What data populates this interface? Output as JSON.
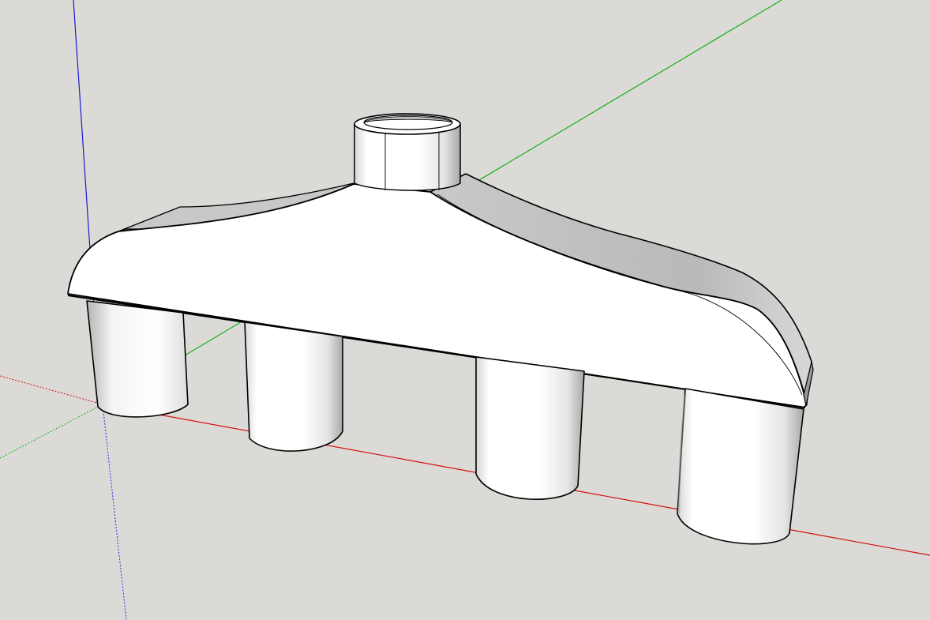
{
  "viewport": {
    "background": "#dcdad6"
  },
  "axes": {
    "x_axis_color": "#cc0000",
    "y_axis_color": "#00aa00",
    "z_axis_color": "#0000cc"
  },
  "model": {
    "face_color": "#ffffff",
    "shade_color": "#b8b8b8",
    "edge_color": "#000000"
  }
}
